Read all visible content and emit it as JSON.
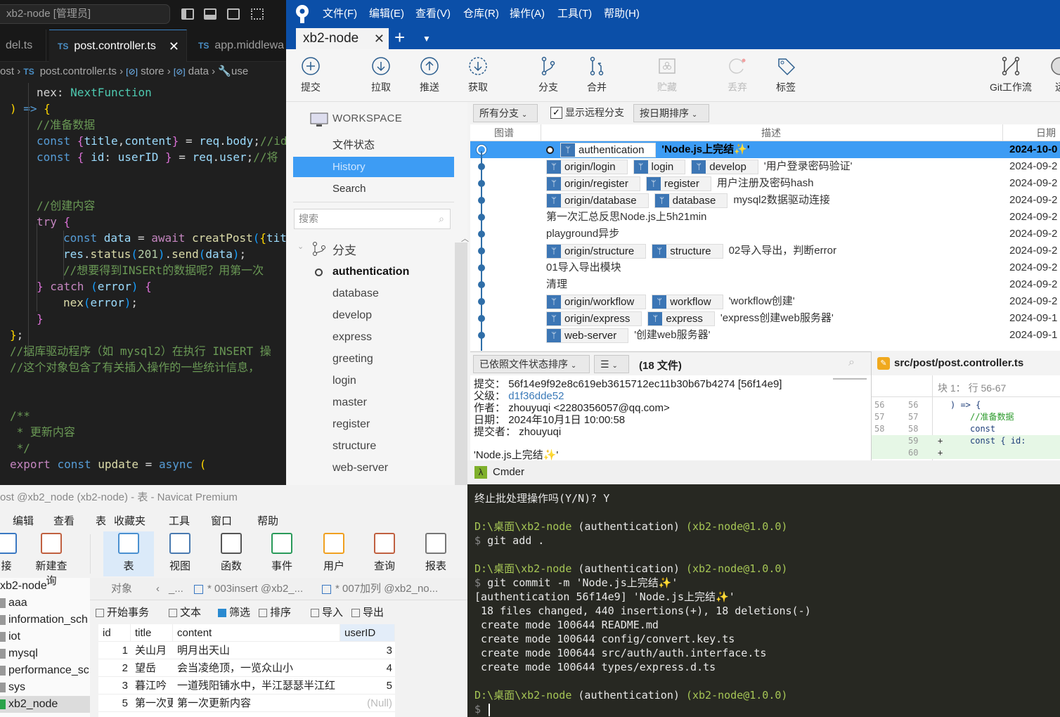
{
  "vscode": {
    "command_center": "xb2-node [管理员]",
    "tabs": [
      {
        "label": "del.ts",
        "active": false
      },
      {
        "label": "post.controller.ts",
        "active": true
      },
      {
        "label": "app.middlewa",
        "active": false
      }
    ],
    "ts_badge": "TS",
    "breadcrumb": [
      "ost",
      "post.controller.ts",
      "store",
      "data",
      "use"
    ],
    "code_lines": [
      "nex: NextFunction",
      ") => {",
      "//准备数据",
      "const {title,content} = req.body;//id",
      "const { id: userID } = req.user;//将",
      "",
      "",
      "//创建内容",
      "try {",
      "const data = await creatPost({tit",
      "res.status(201).send(data);",
      "//想要得到INSERt的数据呢？用第一次",
      "} catch (error) {",
      "nex(error);",
      "}",
      "};",
      "//据库驱动程序（如 mysql2）在执行 INSERT 操",
      "//这个对象包含了有关插入操作的一些统计信息，",
      "",
      "",
      "/**",
      " * 更新内容",
      " */",
      "export const update = async ("
    ]
  },
  "sourcetree": {
    "menu": [
      "文件(F)",
      "编辑(E)",
      "查看(V)",
      "仓库(R)",
      "操作(A)",
      "工具(T)",
      "帮助(H)"
    ],
    "repo_tab": "xb2-node",
    "toolbar": [
      {
        "label": "提交",
        "icon": "plus-circle-icon",
        "enabled": true
      },
      {
        "label": "拉取",
        "icon": "arrow-down-circle-icon",
        "enabled": true
      },
      {
        "label": "推送",
        "icon": "arrow-up-circle-icon",
        "enabled": true
      },
      {
        "label": "获取",
        "icon": "fetch-dashed-circle-icon",
        "enabled": true
      },
      {
        "label": "分支",
        "icon": "branch-icon",
        "enabled": true
      },
      {
        "label": "合并",
        "icon": "merge-icon",
        "enabled": true
      },
      {
        "label": "贮藏",
        "icon": "stash-icon",
        "enabled": false
      },
      {
        "label": "丢弃",
        "icon": "discard-icon",
        "enabled": false
      },
      {
        "label": "标签",
        "icon": "tag-icon",
        "enabled": true
      },
      {
        "label": "Git工作流",
        "icon": "git-flow-icon",
        "enabled": true
      },
      {
        "label": "远",
        "icon": "remote-globe-icon",
        "enabled": true
      }
    ],
    "sidebar": {
      "workspace_title": "WORKSPACE",
      "items": [
        "文件状态",
        "History",
        "Search"
      ],
      "selected": "History",
      "search_placeholder": "搜索",
      "branches_title": "分支",
      "branches": [
        "authentication",
        "database",
        "develop",
        "express",
        "greeting",
        "login",
        "master",
        "register",
        "structure",
        "web-server"
      ],
      "current_branch": "authentication"
    },
    "history_toolbar": {
      "branch_filter": "所有分支",
      "show_remote_label": "显示远程分支",
      "show_remote_checked": true,
      "sort": "按日期排序"
    },
    "history_columns": [
      "图谱",
      "描述",
      "日期"
    ],
    "commits": [
      {
        "branches": [
          "authentication"
        ],
        "message": "'Node.js上完结✨'",
        "date": "2024-10-0",
        "selected": true,
        "head": true
      },
      {
        "branches": [
          "origin/login",
          "login",
          "develop"
        ],
        "message": "'用户登录密码验证'",
        "date": "2024-09-2"
      },
      {
        "branches": [
          "origin/register",
          "register"
        ],
        "message": "用户注册及密码hash",
        "date": "2024-09-2"
      },
      {
        "branches": [
          "origin/database",
          "database"
        ],
        "message": "mysql2数据驱动连接",
        "date": "2024-09-2"
      },
      {
        "branches": [],
        "message": "第一次汇总反思Node.js上5h21min",
        "date": "2024-09-2"
      },
      {
        "branches": [],
        "message": "playground异步",
        "date": "2024-09-2"
      },
      {
        "branches": [
          "origin/structure",
          "structure"
        ],
        "message": "02导入导出，判断error",
        "date": "2024-09-2"
      },
      {
        "branches": [],
        "message": "01导入导出模块",
        "date": "2024-09-2"
      },
      {
        "branches": [],
        "message": "清理",
        "date": "2024-09-2"
      },
      {
        "branches": [
          "origin/workflow",
          "workflow"
        ],
        "message": "'workflow创建'",
        "date": "2024-09-2"
      },
      {
        "branches": [
          "origin/express",
          "express"
        ],
        "message": "'express创建web服务器'",
        "date": "2024-09-1"
      },
      {
        "branches": [
          "web-server"
        ],
        "message": "'创建web服务器'",
        "date": "2024-09-1"
      }
    ],
    "details_toolbar": {
      "sort": "已依照文件状态排序",
      "view": "☰",
      "file_count": "(18 文件)"
    },
    "commit_details": {
      "commit_label": "提交：",
      "commit": "56f14e9f92e8c619eb3615712ec11b30b67b4274 [56f14e9]",
      "parent_label": "父级：",
      "parent": "d1f36dde52",
      "author_label": "作者：",
      "author": "zhouyuqi <2280356057@qq.com>",
      "date_label": "日期：",
      "date": "2024年10月1日 10:00:58",
      "committer_label": "提交者：",
      "committer": "zhouyuqi",
      "message": "'Node.js上完结✨'"
    },
    "diff": {
      "file": "src/post/post.controller.ts",
      "hunk": "块 1： 行 56-67",
      "lines": [
        {
          "old": "56",
          "new": "56",
          "sign": "",
          "text": ") => {",
          "added": false
        },
        {
          "old": "57",
          "new": "57",
          "sign": "",
          "text": "//准备数据",
          "added": false
        },
        {
          "old": "58",
          "new": "58",
          "sign": "",
          "text": "const {title,conte",
          "added": false
        },
        {
          "old": "",
          "new": "59",
          "sign": "+",
          "text": "const { id: userID",
          "added": true
        },
        {
          "old": "",
          "new": "60",
          "sign": "+",
          "text": "",
          "added": true
        }
      ]
    }
  },
  "navicat": {
    "title": "ost @xb2_node (xb2-node) - 表 - Navicat Premium",
    "menu": [
      "编辑",
      "查看",
      "表",
      "收藏夹",
      "工具",
      "窗口",
      "帮助"
    ],
    "toolbar": [
      {
        "label": "接",
        "icon": "connection-icon"
      },
      {
        "label": "新建查询",
        "icon": "new-query-icon"
      },
      {
        "label": "表",
        "icon": "table-icon",
        "active": true
      },
      {
        "label": "视图",
        "icon": "view-icon"
      },
      {
        "label": "函数",
        "icon": "function-icon"
      },
      {
        "label": "事件",
        "icon": "event-clock-icon"
      },
      {
        "label": "用户",
        "icon": "user-icon"
      },
      {
        "label": "查询",
        "icon": "query-icon"
      },
      {
        "label": "报表",
        "icon": "report-icon"
      }
    ],
    "tree": [
      "xb2-node",
      "aaa",
      "information_sch",
      "iot",
      "mysql",
      "performance_sc",
      "sys",
      "xb2_node"
    ],
    "tree_selected": "xb2_node",
    "tabs": [
      "对象",
      "_...",
      "* 003insert @xb2_...",
      "* 007加列 @xb2_no..."
    ],
    "actions": [
      "开始事务",
      "文本",
      "筛选",
      "排序",
      "导入",
      "导出"
    ],
    "columns": [
      "id",
      "title",
      "content",
      "userID"
    ],
    "rows": [
      {
        "id": "1",
        "title": "关山月",
        "content": "明月出天山",
        "userID": "3"
      },
      {
        "id": "2",
        "title": "望岳",
        "content": "会当凌绝顶，一览众山小",
        "userID": "4"
      },
      {
        "id": "3",
        "title": "暮江吟",
        "content": "一道残阳铺水中，半江瑟瑟半江红",
        "userID": "5"
      },
      {
        "id": "5",
        "title": "第一次更",
        "content": "第一次更新内容",
        "userID": "(Null)"
      }
    ]
  },
  "cmder": {
    "title": "Cmder",
    "lines": [
      {
        "type": "out",
        "text": "终止批处理操作吗(Y/N)? Y"
      },
      {
        "type": "blank",
        "text": ""
      },
      {
        "type": "prompt",
        "path": "D:\\桌面\\xb2-node",
        "branch": " (authentication)",
        "pkg": " (xb2-node@1.0.0)"
      },
      {
        "type": "cmd",
        "text": "git add ."
      },
      {
        "type": "blank",
        "text": ""
      },
      {
        "type": "prompt",
        "path": "D:\\桌面\\xb2-node",
        "branch": " (authentication)",
        "pkg": " (xb2-node@1.0.0)"
      },
      {
        "type": "cmd",
        "text": "git commit -m 'Node.js上完结✨'"
      },
      {
        "type": "out",
        "text": "[authentication 56f14e9] 'Node.js上完结✨'"
      },
      {
        "type": "out",
        "text": " 18 files changed, 440 insertions(+), 18 deletions(-)"
      },
      {
        "type": "out",
        "text": " create mode 100644 README.md"
      },
      {
        "type": "out",
        "text": " create mode 100644 config/convert.key.ts"
      },
      {
        "type": "out",
        "text": " create mode 100644 src/auth/auth.interface.ts"
      },
      {
        "type": "out",
        "text": " create mode 100644 types/express.d.ts"
      },
      {
        "type": "blank",
        "text": ""
      },
      {
        "type": "prompt",
        "path": "D:\\桌面\\xb2-node",
        "branch": " (authentication)",
        "pkg": " (xb2-node@1.0.0)"
      },
      {
        "type": "cmd",
        "text": ""
      }
    ],
    "prompt_symbol": "$"
  }
}
